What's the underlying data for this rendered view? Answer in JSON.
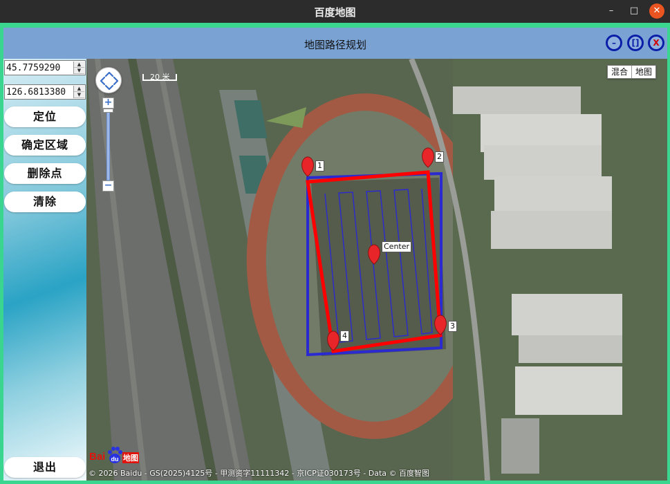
{
  "window": {
    "title": "百度地图",
    "minimize_symbol": "–",
    "maximize_symbol": "□",
    "close_symbol": "✕"
  },
  "app": {
    "title": "地图路径规划",
    "header_buttons": {
      "minimize_symbol": "–",
      "maximize_symbol": "[]",
      "close_symbol": "X"
    }
  },
  "sidebar": {
    "latitude": "45.7759290",
    "longitude": "126.6813380",
    "buttons": {
      "locate": "定位",
      "define_area": "确定区域",
      "delete_point": "删除点",
      "clear": "清除",
      "exit": "退出"
    }
  },
  "map": {
    "zoom_in_symbol": "+",
    "zoom_out_symbol": "−",
    "scale_label": "20 米",
    "type_switch": {
      "hybrid": "混合",
      "map": "地图"
    },
    "markers": {
      "p1": "1",
      "p2": "2",
      "p3": "3",
      "p4": "4",
      "center": "Center"
    },
    "logo": {
      "bai": "Bai",
      "du": "du",
      "cn": "地图"
    },
    "copyright": "© 2026 Baidu - GS(2025)4125号 - 甲测资字11111342 - 京ICP证030173号 - Data © 百度智图",
    "colors": {
      "route_boundary": "#ff0000",
      "survey_path": "#2a2ad0",
      "marker": "#e8262a"
    }
  }
}
